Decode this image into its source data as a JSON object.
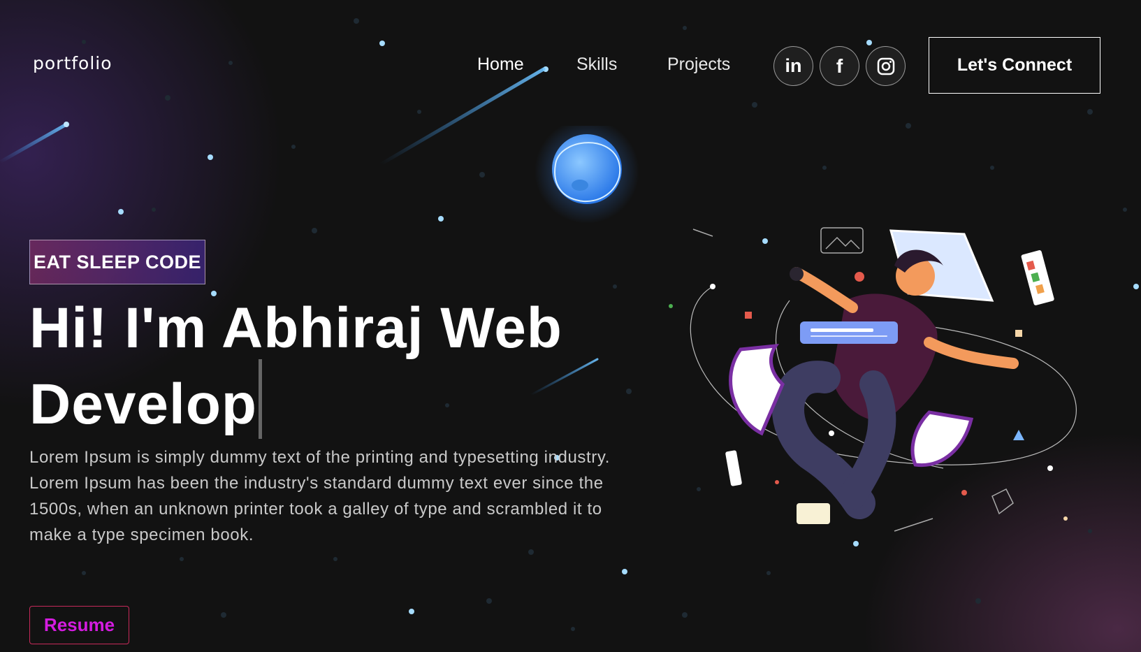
{
  "nav": {
    "logo": "portfolio",
    "links": [
      {
        "label": "Home",
        "active": true
      },
      {
        "label": "Skills",
        "active": false
      },
      {
        "label": "Projects",
        "active": false
      }
    ],
    "social": [
      {
        "icon": "linkedin-icon",
        "label": "in"
      },
      {
        "icon": "facebook-icon",
        "label": "f"
      },
      {
        "icon": "instagram-icon",
        "label": ""
      }
    ],
    "connect_label": "Let's Connect"
  },
  "hero": {
    "tagline": "EAT SLEEP CODE",
    "headline_line1": "Hi! I'm Abhiraj Web",
    "headline_line2": "Develop",
    "description": "Lorem Ipsum is simply dummy text of the printing and typesetting industry. Lorem Ipsum has been the industry's standard dummy text ever since the 1500s, when an unknown printer took a galley of type and scrambled it to make a type specimen book.",
    "resume_label": "Resume"
  },
  "colors": {
    "background": "#121212",
    "accent_purple": "#4a2fbd",
    "accent_pink": "#aa367c",
    "resume_text": "#d41ce0",
    "planet": "#4aa3ff"
  }
}
